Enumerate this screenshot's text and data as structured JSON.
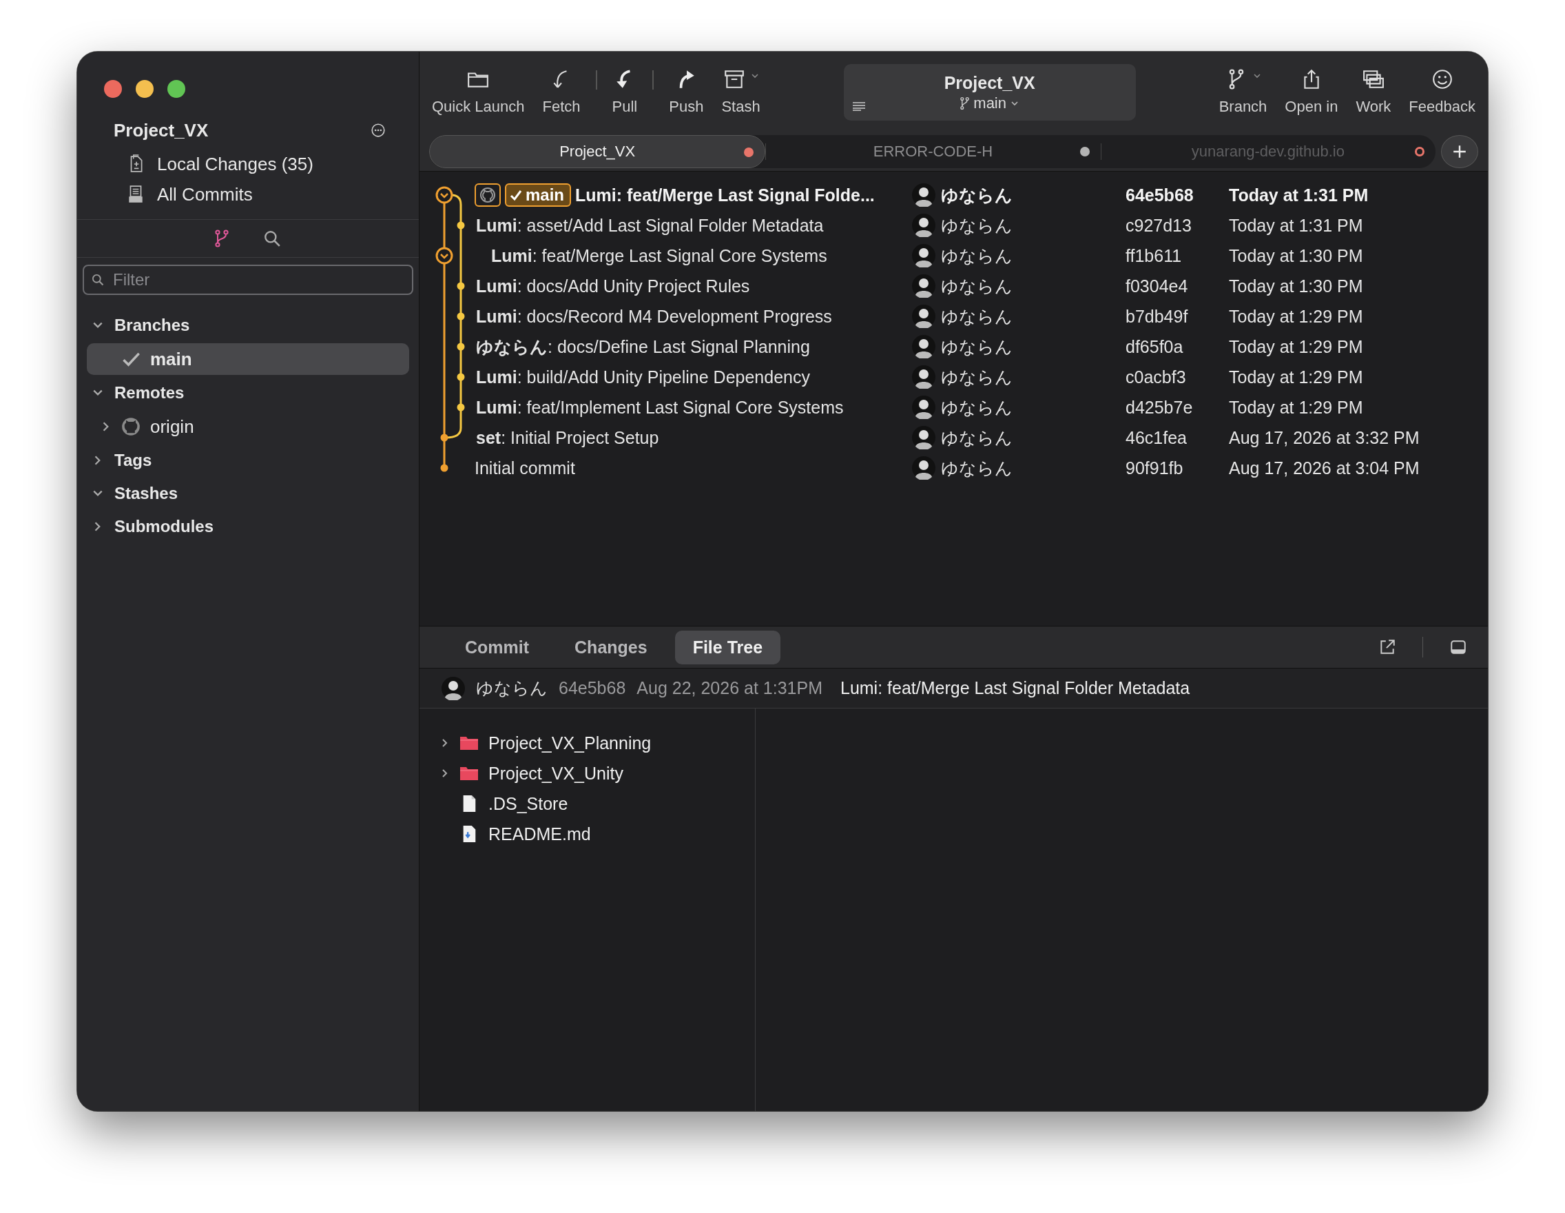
{
  "toolbar": {
    "buttons": [
      {
        "label": "Quick Launch",
        "has_menu": false
      },
      {
        "label": "Fetch",
        "has_menu": false
      },
      {
        "label": "Pull",
        "has_menu": false
      },
      {
        "label": "Push",
        "has_menu": false
      },
      {
        "label": "Stash",
        "has_menu": true
      }
    ],
    "repo_selector": {
      "title": "Project_VX",
      "branch": "main"
    },
    "right_buttons": [
      {
        "label": "Branch",
        "has_menu": true
      },
      {
        "label": "Open in",
        "has_menu": false
      },
      {
        "label": "Work",
        "has_menu": false
      },
      {
        "label": "Feedback",
        "has_menu": false
      }
    ]
  },
  "tabs": [
    {
      "label": "Project_VX",
      "selected": true,
      "ring": false,
      "color": "#e8756a"
    },
    {
      "label": "ERROR-CODE-H",
      "selected": false,
      "ring": false,
      "color": "#b4b4b4"
    },
    {
      "label": "yunarang-dev.github.io",
      "selected": false,
      "ring": true,
      "color": "#e8756a"
    }
  ],
  "sidebar": {
    "repo": "Project_VX",
    "items": [
      {
        "label": "Local Changes (35)"
      },
      {
        "label": "All Commits"
      }
    ],
    "modes": [
      {
        "selected": true
      },
      {
        "selected": false
      }
    ],
    "filter": {
      "placeholder": "Filter"
    },
    "tree": [
      {
        "label": "Branches",
        "expanded": true,
        "children": [
          {
            "label": "main",
            "selected": true
          }
        ]
      },
      {
        "label": "Remotes",
        "expanded": true,
        "children": [
          {
            "label": "origin",
            "expanded": false
          }
        ]
      },
      {
        "label": "Tags",
        "expanded": false
      },
      {
        "label": "Stashes",
        "expanded": true
      },
      {
        "label": "Submodules",
        "expanded": false
      }
    ]
  },
  "commits": [
    {
      "message": "Lumi: feat/Merge Last Signal Folde...",
      "author": "ゆならん",
      "hash": "64e5b68",
      "date": "Today at 1:31 PM",
      "head": true,
      "kind": "merge",
      "refs": [
        {
          "kind": "remote"
        },
        {
          "kind": "local",
          "label": "main"
        }
      ]
    },
    {
      "message": "**Lumi**: asset/Add Last Signal Folder Metadata",
      "author": "ゆならん",
      "hash": "c927d13",
      "date": "Today at 1:31 PM",
      "head": false,
      "kind": "side"
    },
    {
      "message": "**Lumi**: feat/Merge Last Signal Core Systems",
      "author": "ゆならん",
      "hash": "ff1b611",
      "date": "Today at 1:30 PM",
      "head": false,
      "kind": "merge"
    },
    {
      "message": "**Lumi**: docs/Add Unity Project Rules",
      "author": "ゆならん",
      "hash": "f0304e4",
      "date": "Today at 1:30 PM",
      "head": false,
      "kind": "side"
    },
    {
      "message": "**Lumi**: docs/Record M4 Development Progress",
      "author": "ゆならん",
      "hash": "b7db49f",
      "date": "Today at 1:29 PM",
      "head": false,
      "kind": "side"
    },
    {
      "message": "**ゆならん**: docs/Define Last Signal Planning",
      "author": "ゆならん",
      "hash": "df65f0a",
      "date": "Today at 1:29 PM",
      "head": false,
      "kind": "side"
    },
    {
      "message": "**Lumi**: build/Add Unity Pipeline Dependency",
      "author": "ゆならん",
      "hash": "c0acbf3",
      "date": "Today at 1:29 PM",
      "head": false,
      "kind": "side"
    },
    {
      "message": "**Lumi**: feat/Implement Last Signal Core Systems",
      "author": "ゆならん",
      "hash": "d425b7e",
      "date": "Today at 1:29 PM",
      "head": false,
      "kind": "side"
    },
    {
      "message": "**set**: Initial Project Setup",
      "author": "ゆならん",
      "hash": "46c1fea",
      "date": "Aug 17, 2026 at 3:32 PM",
      "head": false,
      "kind": "commit"
    },
    {
      "message": "Initial commit",
      "author": "ゆならん",
      "hash": "90f91fb",
      "date": "Aug 17, 2026 at 3:04 PM",
      "head": false,
      "kind": "root"
    }
  ],
  "detail": {
    "tabs": [
      {
        "label": "Commit",
        "selected": false
      },
      {
        "label": "Changes",
        "selected": false
      },
      {
        "label": "File Tree",
        "selected": true
      }
    ],
    "author": "ゆならん",
    "hash": "64e5b68",
    "date": "Aug 22, 2026 at 1:31PM",
    "message": "Lumi: feat/Merge Last Signal Folder Metadata",
    "files": [
      {
        "name": "Project_VX_Planning",
        "kind": "folder",
        "expanded": false
      },
      {
        "name": "Project_VX_Unity",
        "kind": "folder",
        "expanded": false
      },
      {
        "name": ".DS_Store",
        "kind": "file"
      },
      {
        "name": "README.md",
        "kind": "markdown"
      }
    ]
  }
}
